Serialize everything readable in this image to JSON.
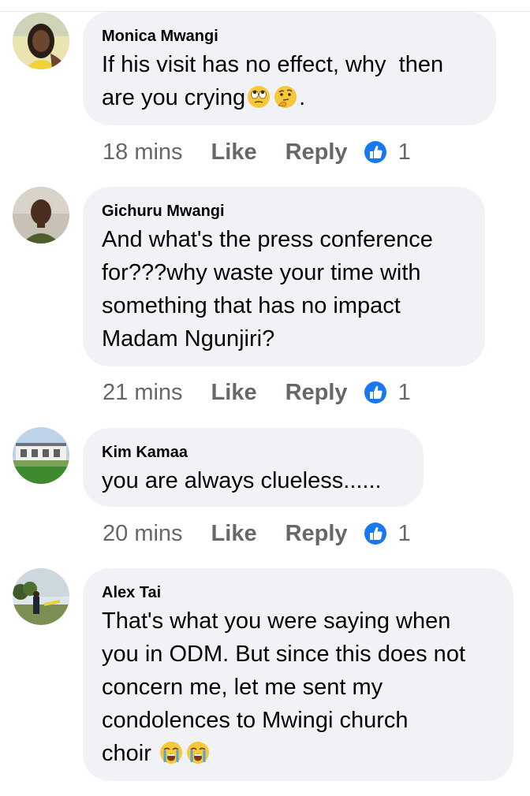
{
  "comments": [
    {
      "author": "Monica Mwangi",
      "lines": [
        "If his visit has no effect, why  then",
        "are you crying"
      ],
      "line2_suffix": ".",
      "emoji": [
        "face-with-rolling-eyes",
        "thinking-face"
      ],
      "time": "18 mins",
      "like_label": "Like",
      "reply_label": "Reply",
      "reaction": "like-icon",
      "reaction_count": "1"
    },
    {
      "author": "Gichuru Mwangi",
      "lines": [
        "And what's the press conference",
        "for???why waste your time with",
        "something that has no impact",
        "Madam Ngunjiri?"
      ],
      "time": "21 mins",
      "like_label": "Like",
      "reply_label": "Reply",
      "reaction": "like-icon",
      "reaction_count": "1"
    },
    {
      "author": "Kim Kamaa",
      "lines": [
        "you are always clueless......"
      ],
      "time": "20 mins",
      "like_label": "Like",
      "reply_label": "Reply",
      "reaction": "like-icon",
      "reaction_count": "1"
    },
    {
      "author": "Alex Tai",
      "lines": [
        "That's what you were saying when",
        "you in ODM. But since this does not",
        "concern me, let me sent my",
        "condolences to Mwingi church",
        "choir"
      ],
      "emoji": [
        "loudly-crying-face",
        "loudly-crying-face"
      ]
    }
  ],
  "colors": {
    "bubble": "#f0f2f5",
    "meta_text": "#65676b",
    "like_blue": "#1877f2"
  }
}
